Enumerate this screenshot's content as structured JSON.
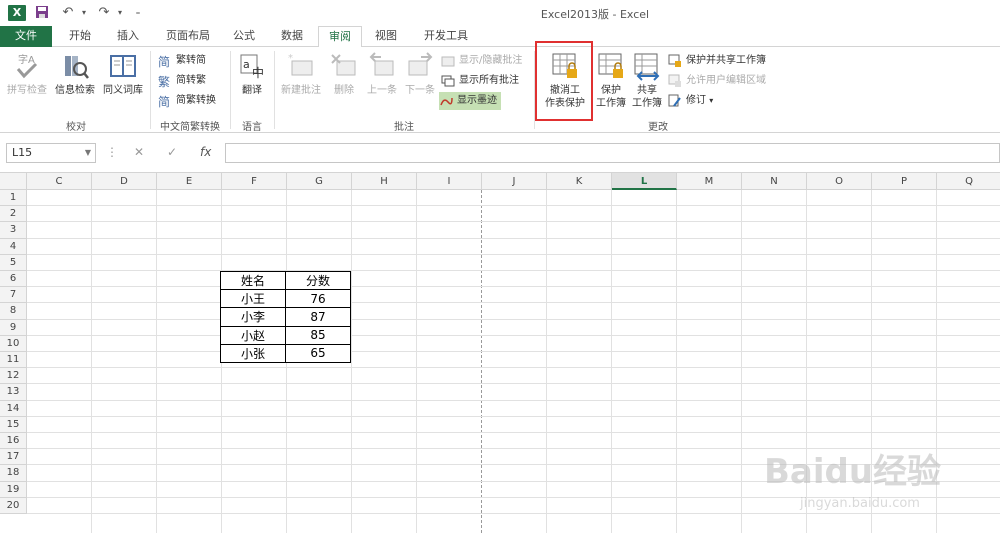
{
  "window": {
    "title": "Excel2013版 - Excel"
  },
  "tabs": [
    {
      "label": "文件"
    },
    {
      "label": "开始"
    },
    {
      "label": "插入"
    },
    {
      "label": "页面布局"
    },
    {
      "label": "公式"
    },
    {
      "label": "数据"
    },
    {
      "label": "审阅"
    },
    {
      "label": "视图"
    },
    {
      "label": "开发工具"
    }
  ],
  "ribbon": {
    "proofing": {
      "label": "校对",
      "spell": "拼写检查",
      "research": "信息检索",
      "thesaurus": "同义词库"
    },
    "chinese_conv": {
      "label": "中文简繁转换",
      "t2s": "繁转简",
      "s2t": "简转繁",
      "convert": "简繁转换"
    },
    "language": {
      "label": "语言",
      "translate": "翻译"
    },
    "comments": {
      "label": "批注",
      "new": "新建批注",
      "delete": "删除",
      "prev": "上一条",
      "next": "下一条",
      "show_hide": "显示/隐藏批注",
      "show_all": "显示所有批注",
      "show_ink": "显示墨迹"
    },
    "changes": {
      "label": "更改",
      "unprotect_sheet_l1": "撤消工",
      "unprotect_sheet_l2": "作表保护",
      "protect_wb_l1": "保护",
      "protect_wb_l2": "工作簿",
      "share_wb_l1": "共享",
      "share_wb_l2": "工作簿",
      "protect_share": "保护并共享工作簿",
      "allow_edit": "允许用户编辑区域",
      "track": "修订"
    }
  },
  "formula_bar": {
    "name_box": "L15",
    "fx": "fx"
  },
  "columns": [
    "C",
    "D",
    "E",
    "F",
    "G",
    "H",
    "I",
    "J",
    "K",
    "L",
    "M",
    "N",
    "O",
    "P",
    "Q"
  ],
  "selected_column": "L",
  "rows": [
    "1",
    "2",
    "3",
    "4",
    "5",
    "6",
    "7",
    "8",
    "9",
    "10",
    "11",
    "12",
    "13",
    "14",
    "15",
    "16",
    "17",
    "18",
    "19",
    "20"
  ],
  "table": {
    "headers": [
      "姓名",
      "分数"
    ],
    "rows": [
      [
        "小王",
        "76"
      ],
      [
        "小李",
        "87"
      ],
      [
        "小赵",
        "85"
      ],
      [
        "小张",
        "65"
      ]
    ]
  },
  "watermark": {
    "brand": "Baidu经验",
    "url": "jingyan.baidu.com"
  },
  "colors": {
    "excel_green": "#217346",
    "highlight_box": "#e03030"
  }
}
